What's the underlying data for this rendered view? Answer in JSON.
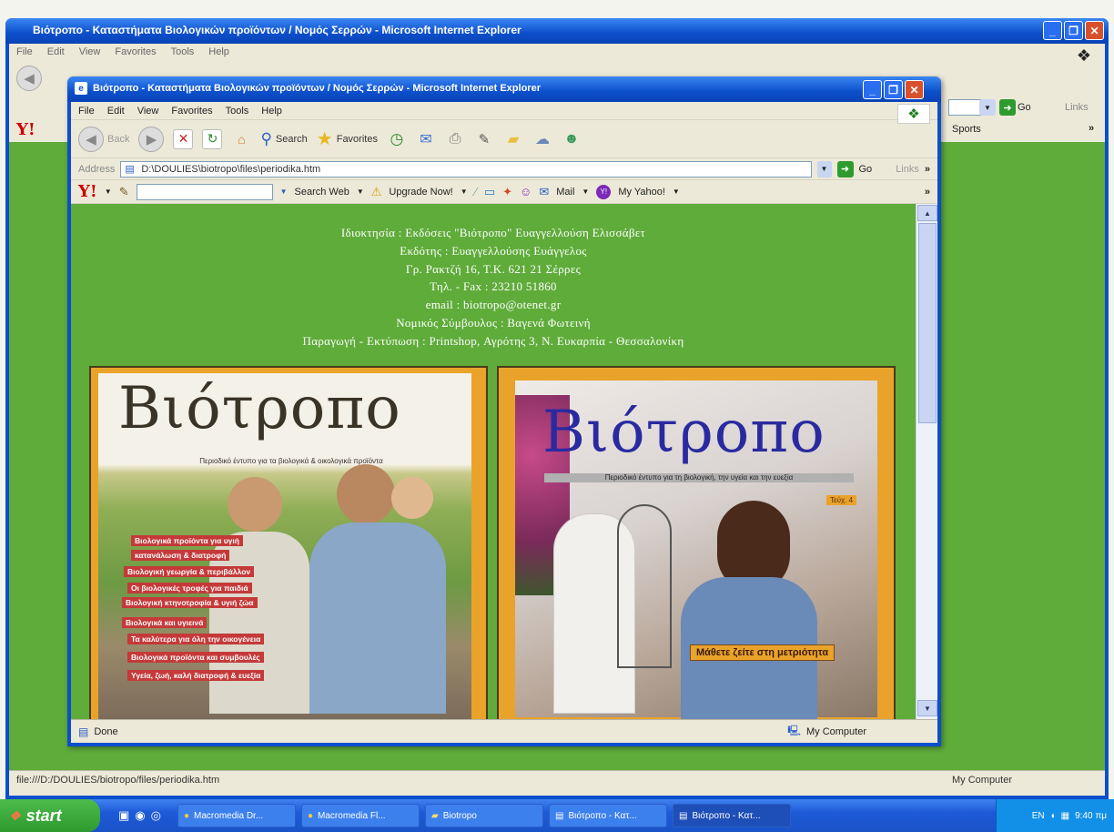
{
  "bg_window": {
    "title": "Βιότροπο - Καταστήματα Βιολογικών προϊόντων / Νομός Σερρών - Microsoft Internet Explorer",
    "menu": [
      "File",
      "Edit",
      "View",
      "Favorites",
      "Tools",
      "Help"
    ],
    "go_label": "Go",
    "links_label": "Links",
    "sports_label": "Sports",
    "status_text": "file:///D:/DOULIES/biotropo/files/periodika.htm",
    "status_zone": "My Computer"
  },
  "fg_window": {
    "title": "Βιότροπο - Καταστήματα Βιολογικών προϊόντων / Νομός Σερρών - Microsoft Internet Explorer",
    "menu": [
      "File",
      "Edit",
      "View",
      "Favorites",
      "Tools",
      "Help"
    ],
    "toolbar": {
      "back": "Back",
      "search": "Search",
      "favorites": "Favorites"
    },
    "address_label": "Address",
    "address": "D:\\DOULIES\\biotropo\\files\\periodika.htm",
    "go_label": "Go",
    "links_label": "Links",
    "yahoo": {
      "logo": "Y!",
      "search_web": "Search Web",
      "upgrade": "Upgrade Now!",
      "mail": "Mail",
      "my_yahoo": "My Yahoo!"
    },
    "status_text": "Done",
    "status_zone": "My Computer"
  },
  "page": {
    "info_lines": [
      "Ιδιοκτησία : Εκδόσεις \"Βιότροπο\" Ευαγγελλούση Ελισσάβετ",
      "Εκδότης : Ευαγγελλούσης Ευάγγελος",
      "Γρ. Ρακτζή 16, Τ.Κ. 621 21 Σέρρες",
      "Τηλ. - Fax : 23210 51860",
      "email : biotropo@otenet.gr",
      "Νομικός Σύμβουλος : Βαγενά Φωτεινή",
      "Παραγωγή - Εκτύπωση : Printshop, Αγρότης 3, Ν. Ευκαρπία - Θεσσαλονίκη"
    ],
    "cover1": {
      "title": "Βιότροπο",
      "subtitle": "Περιοδικό έντυπο για τα βιολογικά & οικολογικά προϊόντα",
      "taglines": [
        "Βιολογικά προϊόντα για υγιή",
        "κατανάλωση & διατροφή",
        "Βιολογική γεωργία & περιβάλλον",
        "Οι βιολογικές τροφές για παιδιά",
        "Βιολογική κτηνοτροφία & υγιή ζώα",
        "Βιολογικά και υγιεινά",
        "Τα καλύτερα για όλη την οικογένεια",
        "Βιολογικά προϊόντα και συμβουλές",
        "Υγεία, ζωή, καλή διατροφή & ευεξία"
      ]
    },
    "cover2": {
      "title": "Βιότροπο",
      "subtitle": "Περιοδικό έντυπο για τη βιολογική, την υγεία και την ευεξία",
      "issue_tag": "Τεύχ. 4",
      "caption": "Μάθετε ζείτε στη μετριότητα"
    }
  },
  "taskbar": {
    "start": "start",
    "tasks": [
      "Macromedia Dr...",
      "Macromedia Fl...",
      "Biotropo",
      "Βιότροπο - Κατ...",
      "Βιότροπο - Κατ..."
    ],
    "lang": "EN",
    "clock": "9:40 πμ"
  },
  "colors": {
    "page_bg": "#5fac3a",
    "xp_blue": "#0c4fcb",
    "cover_orange": "#e9a32a"
  }
}
